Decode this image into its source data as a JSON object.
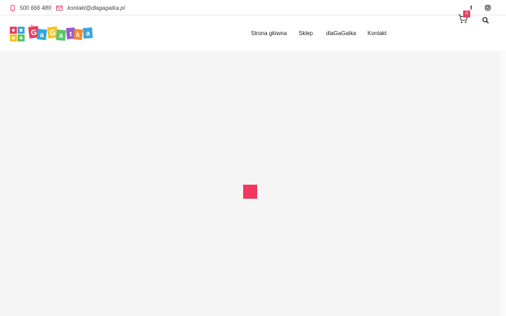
{
  "topbar": {
    "phone": "500 666 489",
    "email": "kontakt@dlagagatka.pl",
    "social": {
      "facebook": "f",
      "instagram_icon": "instagram-icon"
    }
  },
  "header": {
    "logo_text": "dla GaGatka",
    "nav": [
      {
        "label": "Strona główna"
      },
      {
        "label": "Sklep"
      },
      {
        "label": "dlaGaGatka"
      },
      {
        "label": "Kontakt"
      }
    ],
    "cart_count": "0"
  },
  "colors": {
    "accent": "#f2385f",
    "background": "#f5f5f5"
  }
}
